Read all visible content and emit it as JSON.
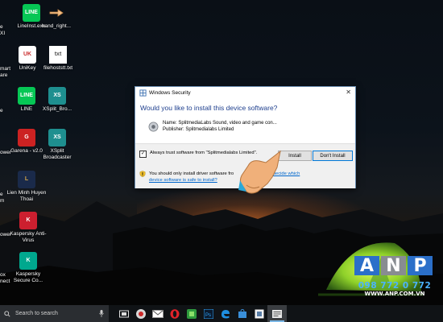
{
  "dialog": {
    "window_title": "Windows Security",
    "question": "Would you like to install this device software?",
    "device_name": "Name: SplitmediaLabs Sound, video and game con...",
    "publisher": "Publisher: Splitmedialabs Limited",
    "trust_checkbox_label": "Always trust software from \"Splitmedialabs Limited\".",
    "trust_checked": true,
    "install_label": "Install",
    "dont_install_label": "Don't Install",
    "warning_text": "You should only install driver software fro",
    "link_text_1": "How can I decide which",
    "link_text_2": "device software is safe to install?"
  },
  "desktop_icons": [
    {
      "label": "LineInst.exe",
      "color": "#06c755",
      "glyph": "LINE"
    },
    {
      "label": "hand_right...",
      "color": "#00000000",
      "glyph": "hand"
    },
    {
      "label": "UniKey",
      "color": "#cc3333",
      "glyph": "UK"
    },
    {
      "label": "filehoststt.txt",
      "color": "#ffffff",
      "glyph": "txt"
    },
    {
      "label": "LINE",
      "color": "#06c755",
      "glyph": "LINE"
    },
    {
      "label": "XSplit_Bro...",
      "color": "#1e8f8f",
      "glyph": "XS"
    },
    {
      "label": "Garena - v2.0",
      "color": "#cc2222",
      "glyph": "G"
    },
    {
      "label": "XSplit Broadcaster",
      "color": "#1e8f8f",
      "glyph": "XS"
    },
    {
      "label": "Lien Minh Huyen Thoai",
      "color": "#1a2a4a",
      "glyph": "L"
    },
    {
      "label": "Kaspersky Anti-Virus",
      "color": "#cc1f2f",
      "glyph": "K"
    },
    {
      "label": "Kaspersky Secure Co...",
      "color": "#00a88e",
      "glyph": "K"
    }
  ],
  "left_partial_labels": [
    "e",
    "XI",
    "mart",
    "are",
    "e",
    "ower",
    "e",
    "m",
    "ome",
    "ower",
    "ox",
    "nect",
    "lo..."
  ],
  "taskbar": {
    "search_placeholder": "Search to search"
  },
  "watermark": {
    "letters": [
      "A",
      "N",
      "P"
    ],
    "letter_colors": [
      "#2b6fc9",
      "#888c91",
      "#2b6fc9"
    ],
    "phone": "098 772 0 772",
    "website": "WWW.ANP.COM.VN"
  }
}
